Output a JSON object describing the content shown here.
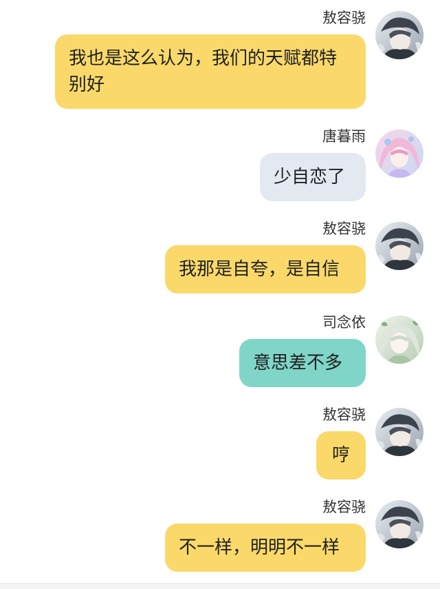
{
  "colors": {
    "yellow_bubble": "#fad96a",
    "gray_bubble": "#e4e8f1",
    "teal_bubble": "#7fd6c8"
  },
  "messages": [
    {
      "sender": "敖容骁",
      "text": "我也是这么认为，我们的天赋都特别好",
      "bubble_color": "yellow",
      "avatar": "boy-avatar-icon"
    },
    {
      "sender": "唐暮雨",
      "text": "少自恋了",
      "bubble_color": "gray",
      "avatar": "pink-girl-avatar-icon"
    },
    {
      "sender": "敖容骁",
      "text": "我那是自夸，是自信",
      "bubble_color": "yellow",
      "avatar": "boy-avatar-icon"
    },
    {
      "sender": "司念依",
      "text": "意思差不多",
      "bubble_color": "teal",
      "avatar": "green-girl-avatar-icon"
    },
    {
      "sender": "敖容骁",
      "text": "哼",
      "bubble_color": "yellow",
      "avatar": "boy-avatar-icon"
    },
    {
      "sender": "敖容骁",
      "text": "不一样，明明不一样",
      "bubble_color": "yellow",
      "avatar": "boy-avatar-icon"
    }
  ]
}
